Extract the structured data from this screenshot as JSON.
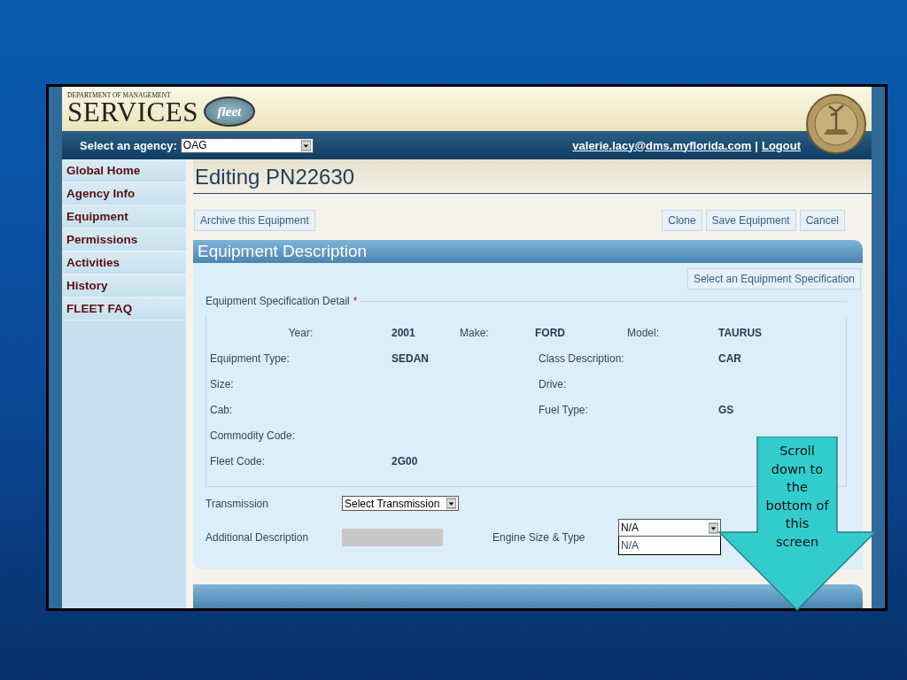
{
  "header": {
    "department": "DEPARTMENT OF MANAGEMENT",
    "services": "SERVICES",
    "fleet": "fleet"
  },
  "agency_bar": {
    "label": "Select an agency:",
    "agency": "OAG",
    "user": "valerie.lacy@dms.myflorida.com",
    "separator": "|",
    "logout": "Logout"
  },
  "sidebar": {
    "items": [
      "Global Home",
      "Agency Info",
      "Equipment",
      "Permissions",
      "Activities",
      "History",
      "FLEET FAQ"
    ]
  },
  "page_title": "Editing PN22630",
  "actions": {
    "left": [
      "Archive this Equipment"
    ],
    "right": [
      "Clone",
      "Save Equipment",
      "Cancel"
    ]
  },
  "section": {
    "title": "Equipment Description",
    "spec_button": "Select an Equipment Specification",
    "legend": "Equipment Specification Detail",
    "required_mark": "*",
    "rows": [
      {
        "kind": "triple",
        "items": [
          {
            "label": "Year:",
            "value": "2001"
          },
          {
            "label": "Make:",
            "value": "FORD"
          },
          {
            "label": "Model:",
            "value": "TAURUS"
          }
        ]
      },
      {
        "kind": "pair",
        "items": [
          {
            "label": "Equipment Type:",
            "value": "SEDAN"
          },
          {
            "label": "Class Description:",
            "value": "CAR"
          }
        ]
      },
      {
        "kind": "pair",
        "items": [
          {
            "label": "Size:"
          },
          {
            "label": "Drive:"
          }
        ]
      },
      {
        "kind": "pair",
        "items": [
          {
            "label": "Cab:"
          },
          {
            "label": "Fuel Type:",
            "value": "GS"
          }
        ]
      },
      {
        "kind": "pair",
        "items": [
          {
            "label": "Commodity Code:"
          }
        ]
      },
      {
        "kind": "pair",
        "items": [
          {
            "label": "Fleet Code:",
            "value": "2G00"
          }
        ]
      }
    ],
    "transmission": {
      "label": "Transmission",
      "value": "Select Transmission"
    },
    "additional": {
      "label": "Additional Description",
      "disabled": true
    },
    "engine": {
      "label": "Engine Size & Type",
      "value": "N/A",
      "expanded": true,
      "options": [
        "N/A"
      ]
    }
  },
  "callout": {
    "text": "Scroll down to the bottom of this screen"
  }
}
